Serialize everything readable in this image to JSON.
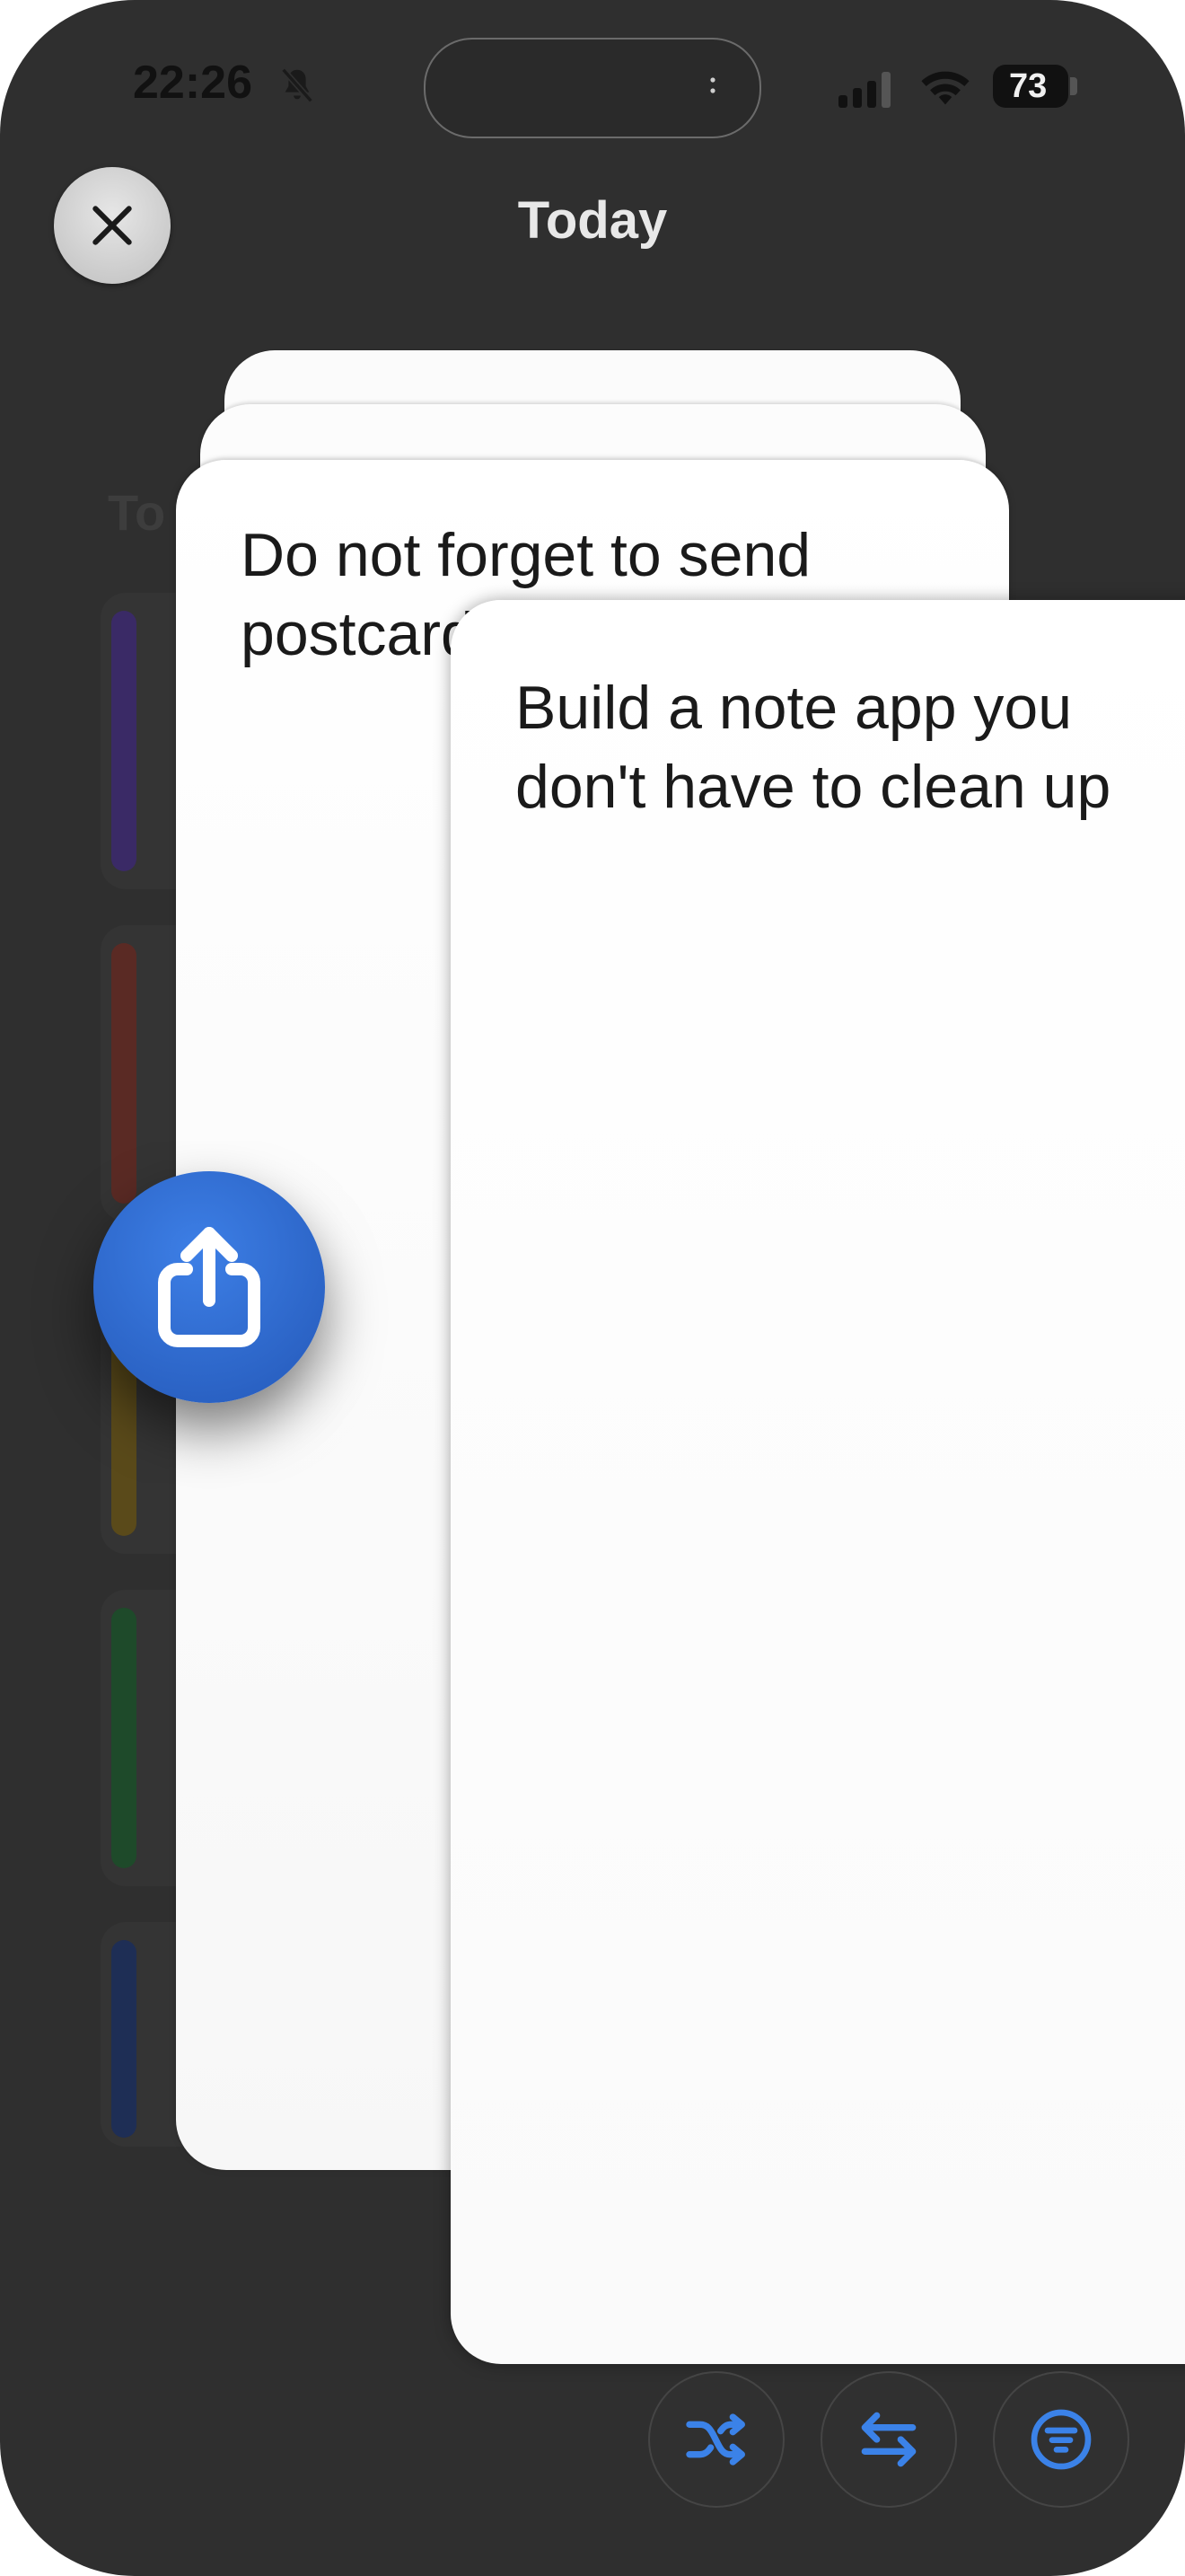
{
  "status_bar": {
    "time": "22:26",
    "battery": "73",
    "icons": [
      "bell-slash-icon",
      "signal-icon",
      "wifi-icon",
      "battery-icon"
    ]
  },
  "header": {
    "title": "Today",
    "close_icon": "close-icon"
  },
  "background_list": {
    "title_fragment": "To",
    "item_colors": [
      "#3a2a66",
      "#5a2a24",
      "#5a4a1a",
      "#1e4a2a",
      "#1e2e55"
    ]
  },
  "cards": {
    "main_text": "Do not forget to send postcards",
    "front_text": "Build a note app you don't have to clean up"
  },
  "actions": {
    "share_icon": "share-icon",
    "toolbar": [
      {
        "name": "shuffle",
        "icon": "shuffle-icon"
      },
      {
        "name": "swap",
        "icon": "swap-arrows-icon"
      },
      {
        "name": "filter",
        "icon": "filter-icon"
      }
    ]
  },
  "colors": {
    "background": "#2f2f2f",
    "accent_blue": "#2e6bd0",
    "toolbar_icon": "#3b82e8"
  }
}
